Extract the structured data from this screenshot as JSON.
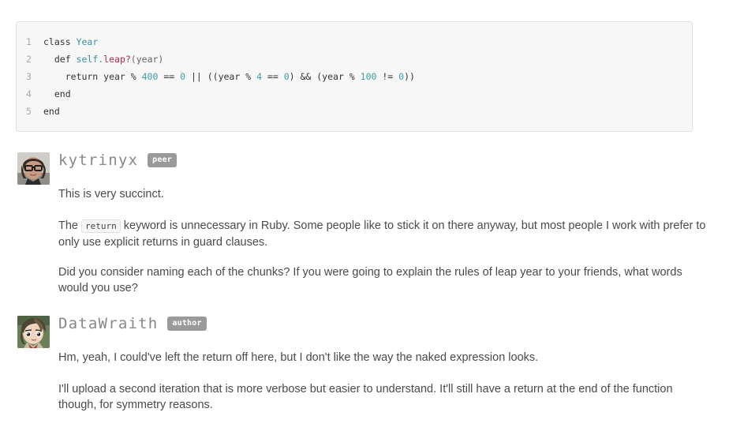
{
  "code_block": {
    "language": "ruby",
    "lines": [
      {
        "number": "1",
        "text": "class Year"
      },
      {
        "number": "2",
        "text": "  def self.leap?(year)"
      },
      {
        "number": "3",
        "text": "    return year % 400 == 0 || ((year % 4 == 0) && (year % 100 != 0))"
      },
      {
        "number": "4",
        "text": "  end"
      },
      {
        "number": "5",
        "text": "end"
      }
    ],
    "tokens": [
      [
        {
          "t": "class",
          "c": "tok-kw"
        },
        {
          "t": " ",
          "c": "tok-punc"
        },
        {
          "t": "Year",
          "c": "tok-cls"
        }
      ],
      [
        {
          "t": "  def ",
          "c": "tok-kw"
        },
        {
          "t": "self.",
          "c": "tok-self"
        },
        {
          "t": "leap?",
          "c": "tok-meth"
        },
        {
          "t": "(year)",
          "c": "tok-punc"
        }
      ],
      [
        {
          "t": "    return year % ",
          "c": "tok-op"
        },
        {
          "t": "400",
          "c": "tok-num"
        },
        {
          "t": " == ",
          "c": "tok-op"
        },
        {
          "t": "0",
          "c": "tok-num"
        },
        {
          "t": " || ((year % ",
          "c": "tok-op"
        },
        {
          "t": "4",
          "c": "tok-num"
        },
        {
          "t": " == ",
          "c": "tok-op"
        },
        {
          "t": "0",
          "c": "tok-num"
        },
        {
          "t": ") && (year % ",
          "c": "tok-op"
        },
        {
          "t": "100",
          "c": "tok-num"
        },
        {
          "t": " != ",
          "c": "tok-op"
        },
        {
          "t": "0",
          "c": "tok-num"
        },
        {
          "t": "))",
          "c": "tok-op"
        }
      ],
      [
        {
          "t": "  end",
          "c": "tok-kw"
        }
      ],
      [
        {
          "t": "end",
          "c": "tok-kw"
        }
      ]
    ]
  },
  "comments": [
    {
      "author": "kytrinyx",
      "badge": "peer",
      "avatar_alt": "kytrinyx-avatar",
      "paragraphs": [
        {
          "parts": [
            {
              "type": "text",
              "value": "This is very succinct."
            }
          ]
        },
        {
          "parts": [
            {
              "type": "text",
              "value": "The "
            },
            {
              "type": "code",
              "value": "return"
            },
            {
              "type": "text",
              "value": " keyword is unnecessary in Ruby. Some people like to stick it on there anyway, but most people I work with prefer to only use explicit returns in guard clauses."
            }
          ]
        },
        {
          "parts": [
            {
              "type": "text",
              "value": "Did you consider naming each of the chunks? If you were going to explain the rules of leap year to your friends, what words would you use?"
            }
          ]
        }
      ]
    },
    {
      "author": "DataWraith",
      "badge": "author",
      "avatar_alt": "datawraith-avatar",
      "paragraphs": [
        {
          "parts": [
            {
              "type": "text",
              "value": "Hm, yeah, I could've left the return off here, but I don't like the way the naked expression looks."
            }
          ]
        },
        {
          "parts": [
            {
              "type": "text",
              "value": "I'll upload a second iteration that is more verbose but easier to understand. It'll still have a return at the end of the function though, for symmetry reasons."
            }
          ]
        }
      ]
    }
  ],
  "colors": {
    "code_background": "#f7f7f7",
    "code_border": "#e2e2e2",
    "badge_background": "#9a9a9a",
    "author_name": "#888888",
    "body_text": "#4a4a4a",
    "keyword": "#333333",
    "class_name": "#3f8fa0",
    "method_name": "#b4274b",
    "number": "#3fa0a0",
    "gutter": "#a8a8a8"
  }
}
